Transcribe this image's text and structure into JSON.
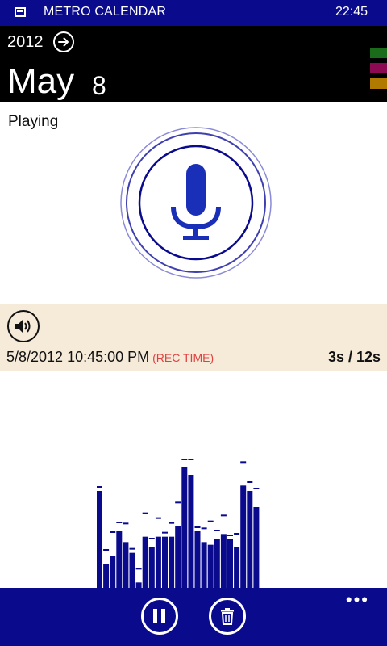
{
  "status_bar": {
    "app_title": "METRO CALENDAR",
    "time": "22:45",
    "icon": "calendar-app-icon"
  },
  "header": {
    "year": "2012",
    "month": "May",
    "day": "8",
    "calendar_colors": [
      "#1a6b1a",
      "#8c0a52",
      "#b07a00"
    ]
  },
  "status": {
    "label": "Playing"
  },
  "recording": {
    "datetime": "5/8/2012 10:45:00 PM",
    "tag": "(REC TIME)",
    "duration": "3s / 12s"
  },
  "meter": {
    "bar_color": "#0a0a8c",
    "levels": [
      36,
      9,
      12,
      21,
      17,
      13,
      2,
      19,
      15,
      19,
      19,
      19,
      23,
      45,
      42,
      21,
      17,
      16,
      18,
      20,
      18,
      15,
      38,
      36,
      30
    ]
  },
  "colors": {
    "accent": "#0a0a8c",
    "mic": "#1a2fb8",
    "panel": "#f6ebd9"
  },
  "app_bar": {
    "more": "•••",
    "buttons": [
      "pause-icon",
      "trash-icon"
    ]
  }
}
